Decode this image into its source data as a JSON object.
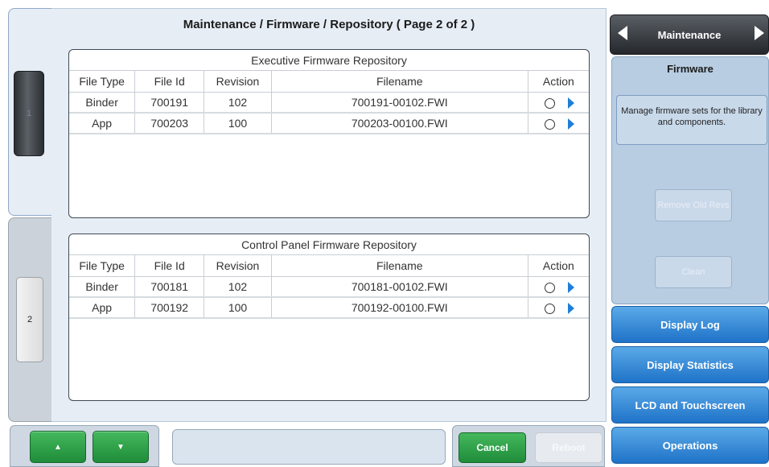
{
  "page_title": "Maintenance / Firmware / Repository ( Page 2 of 2 )",
  "page_rail": {
    "page_1_label": "1",
    "page_2_label": "2"
  },
  "columns": [
    "File Type",
    "File Id",
    "Revision",
    "Filename",
    "Action"
  ],
  "executive_repo": {
    "title": "Executive Firmware Repository",
    "rows": [
      {
        "file_type": "Binder",
        "file_id": "700191",
        "revision": "102",
        "filename": "700191-00102.FWI"
      },
      {
        "file_type": "App",
        "file_id": "700203",
        "revision": "100",
        "filename": "700203-00100.FWI"
      }
    ]
  },
  "control_panel_repo": {
    "title": "Control Panel Firmware Repository",
    "rows": [
      {
        "file_type": "Binder",
        "file_id": "700181",
        "revision": "102",
        "filename": "700181-00102.FWI"
      },
      {
        "file_type": "App",
        "file_id": "700192",
        "revision": "100",
        "filename": "700192-00100.FWI"
      }
    ]
  },
  "bottom_bar": {
    "up_glyph": "▲",
    "down_glyph": "▼",
    "cancel_label": "Cancel",
    "reboot_label": "Reboot"
  },
  "side_menu": {
    "header": "Maintenance",
    "section_title": "Firmware",
    "description": "Manage firmware sets for the library and components.",
    "remove_label": "Remove Old Revs",
    "clean_label": "Clean",
    "nav": [
      "Display Log",
      "Display Statistics",
      "LCD and Touchscreen",
      "Operations"
    ]
  },
  "colors": {
    "accent_blue": "#1f73c8",
    "action_green": "#1f8c3a",
    "header_dark": "#24282c"
  }
}
